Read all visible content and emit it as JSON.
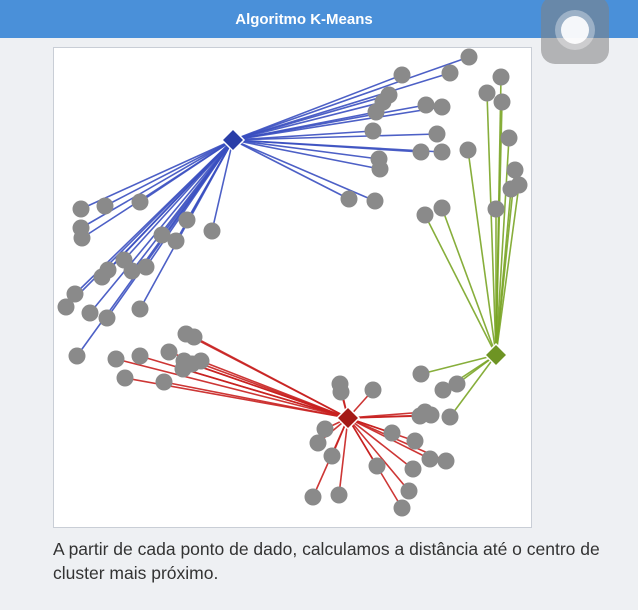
{
  "window": {
    "title": "Algoritmo K-Means"
  },
  "caption": {
    "text": "A partir de cada ponto de dado, calculamos a distância até o centro de cluster mais próximo."
  },
  "colors": {
    "titlebar": "#4a90d9",
    "cluster_blue": "#3a4fc0",
    "cluster_green": "#7aa526",
    "cluster_red": "#c8201f",
    "centroid_blue": "#2a3ea8",
    "centroid_green": "#6e9424",
    "centroid_red": "#a51a16",
    "point": "#8a8a8a"
  },
  "icons": {
    "assistive_touch": "assistive-touch-icon"
  },
  "chart_data": {
    "type": "scatter",
    "title": "",
    "xlabel": "",
    "ylabel": "",
    "grid": false,
    "legend": "none",
    "xlim": [
      0,
      477
    ],
    "ylim": [
      0,
      479
    ],
    "centroids": [
      {
        "cluster": "blue",
        "x": 179,
        "y": 92
      },
      {
        "cluster": "green",
        "x": 442,
        "y": 307
      },
      {
        "cluster": "red",
        "x": 294,
        "y": 370
      }
    ],
    "series": [
      {
        "cluster": "blue",
        "points": [
          [
            415,
            9
          ],
          [
            348,
            27
          ],
          [
            396,
            25
          ],
          [
            335,
            47
          ],
          [
            322,
            64
          ],
          [
            329,
            54
          ],
          [
            372,
            57
          ],
          [
            388,
            59
          ],
          [
            383,
            86
          ],
          [
            319,
            83
          ],
          [
            367,
            104
          ],
          [
            388,
            104
          ],
          [
            325,
            111
          ],
          [
            326,
            121
          ],
          [
            295,
            151
          ],
          [
            321,
            153
          ],
          [
            27,
            161
          ],
          [
            51,
            158
          ],
          [
            86,
            154
          ],
          [
            27,
            180
          ],
          [
            28,
            190
          ],
          [
            133,
            172
          ],
          [
            108,
            187
          ],
          [
            122,
            193
          ],
          [
            158,
            183
          ],
          [
            70,
            212
          ],
          [
            54,
            222
          ],
          [
            92,
            219
          ],
          [
            48,
            229
          ],
          [
            78,
            223
          ],
          [
            21,
            246
          ],
          [
            12,
            259
          ],
          [
            36,
            265
          ],
          [
            53,
            270
          ],
          [
            86,
            261
          ],
          [
            23,
            308
          ]
        ]
      },
      {
        "cluster": "green",
        "points": [
          [
            447,
            29
          ],
          [
            433,
            45
          ],
          [
            448,
            54
          ],
          [
            455,
            90
          ],
          [
            414,
            102
          ],
          [
            461,
            122
          ],
          [
            457,
            141
          ],
          [
            465,
            137
          ],
          [
            442,
            161
          ],
          [
            388,
            160
          ],
          [
            371,
            167
          ],
          [
            367,
            326
          ],
          [
            389,
            342
          ],
          [
            403,
            336
          ],
          [
            396,
            369
          ]
        ]
      },
      {
        "cluster": "red",
        "points": [
          [
            132,
            286
          ],
          [
            140,
            289
          ],
          [
            115,
            304
          ],
          [
            130,
            313
          ],
          [
            138,
            316
          ],
          [
            147,
            313
          ],
          [
            62,
            311
          ],
          [
            86,
            308
          ],
          [
            71,
            330
          ],
          [
            110,
            334
          ],
          [
            129,
            321
          ],
          [
            286,
            336
          ],
          [
            287,
            344
          ],
          [
            319,
            342
          ],
          [
            371,
            364
          ],
          [
            377,
            367
          ],
          [
            366,
            368
          ],
          [
            338,
            385
          ],
          [
            361,
            393
          ],
          [
            376,
            411
          ],
          [
            392,
            413
          ],
          [
            271,
            381
          ],
          [
            264,
            395
          ],
          [
            278,
            408
          ],
          [
            323,
            418
          ],
          [
            359,
            421
          ],
          [
            355,
            443
          ],
          [
            259,
            449
          ],
          [
            285,
            447
          ],
          [
            348,
            460
          ]
        ]
      }
    ]
  }
}
